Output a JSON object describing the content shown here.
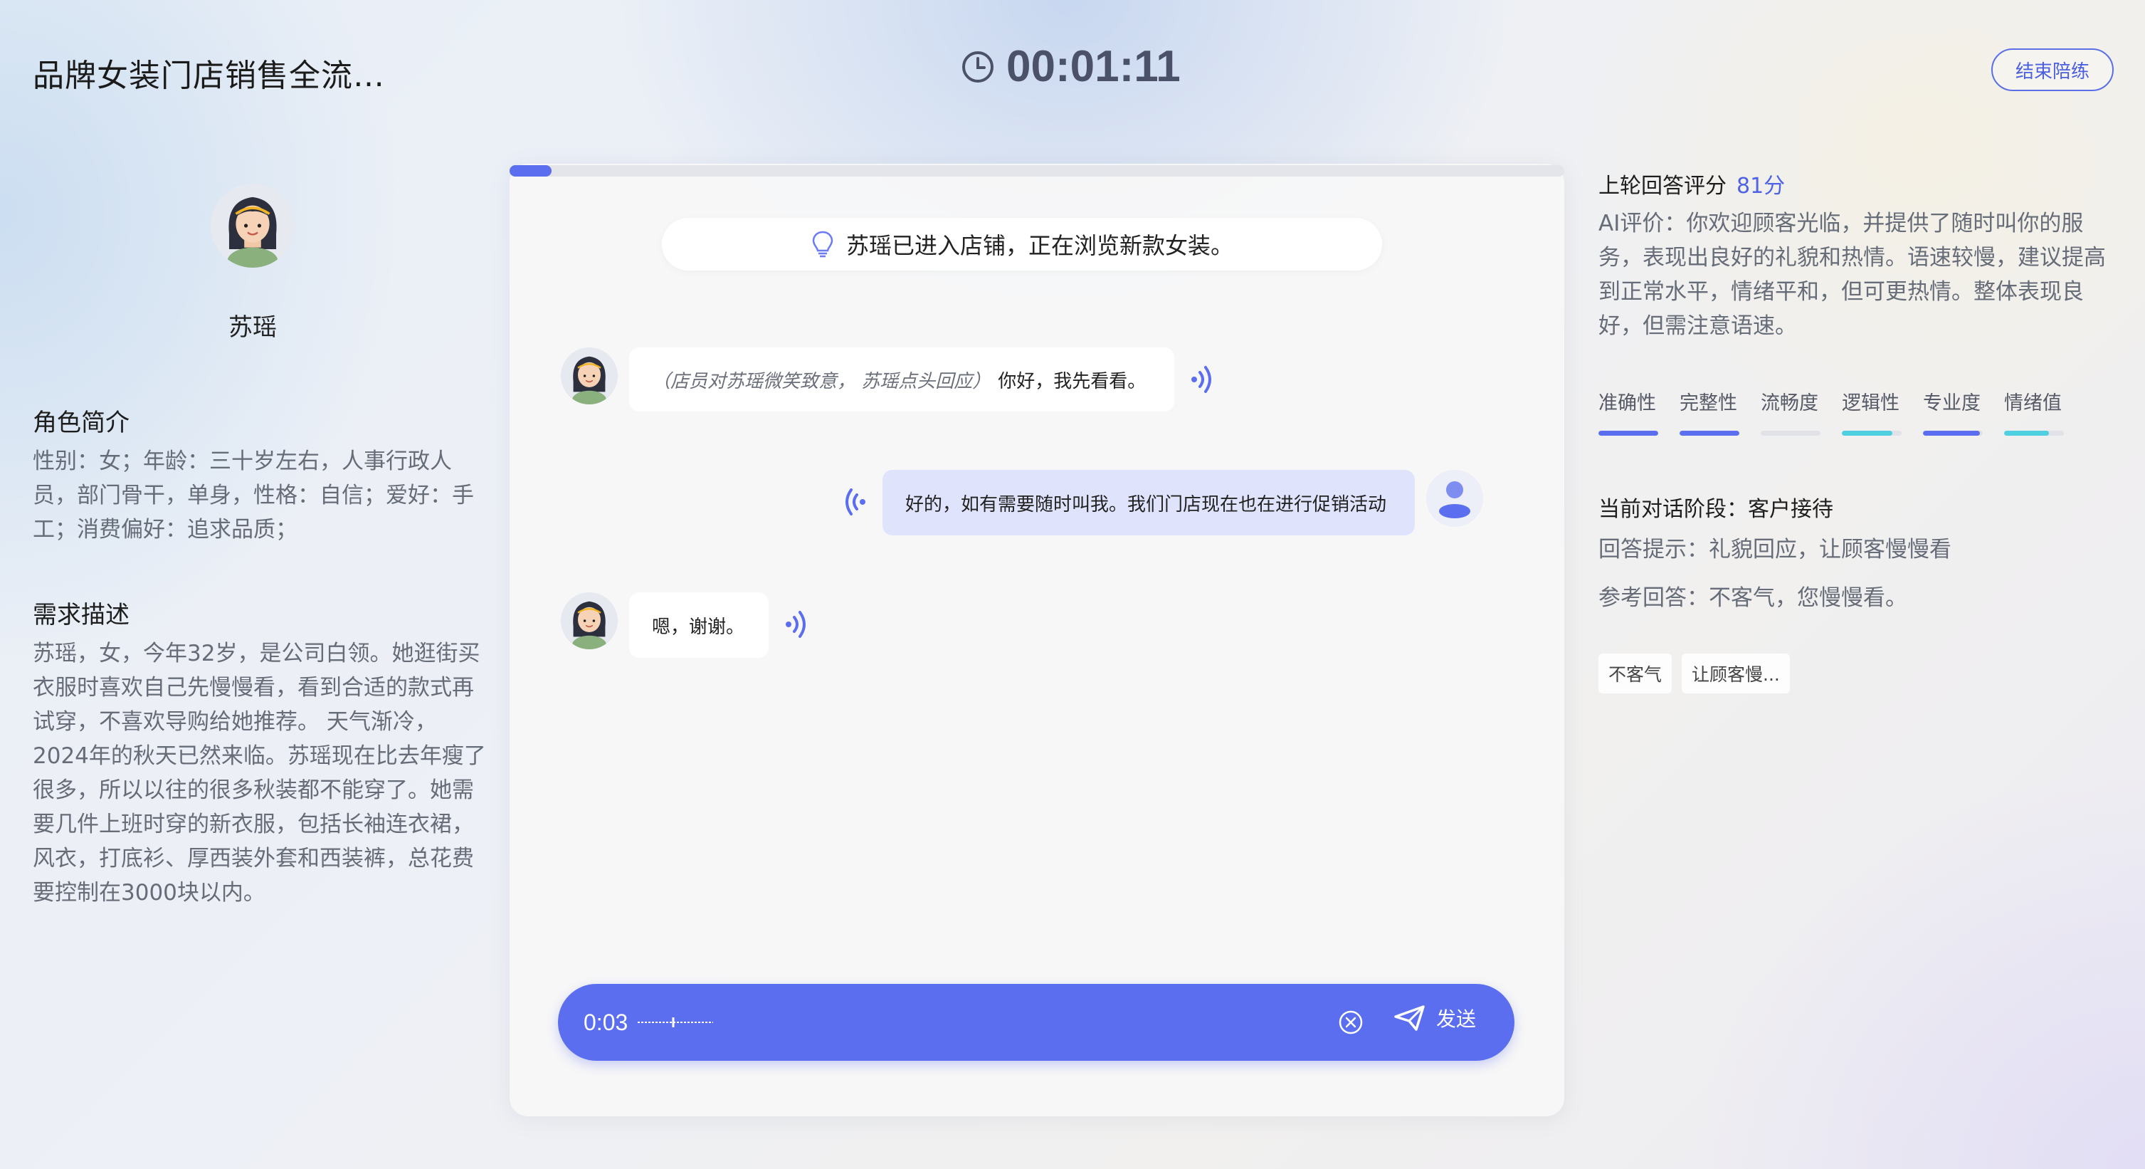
{
  "header": {
    "title": "品牌女装门店销售全流…",
    "timer": "00:01:11",
    "end_button": "结束陪练"
  },
  "character": {
    "name": "苏瑶",
    "intro_title": "角色简介",
    "intro_text": "性别：女；年龄：三十岁左右，人事行政人员，部门骨干，单身，性格：自信；爱好：手工；消费偏好：追求品质；",
    "need_title": "需求描述",
    "need_text": "苏瑶，女，今年32岁，是公司白领。她逛街买衣服时喜欢自己先慢慢看，看到合适的款式再试穿，不喜欢导购给她推荐。 天气渐冷，2024年的秋天已然来临。苏瑶现在比去年瘦了很多，所以以往的很多秋装都不能穿了。她需要几件上班时穿的新衣服，包括长袖连衣裙，风衣，打底衫、厚西装外套和西装裤，总花费要控制在3000块以内。"
  },
  "chat": {
    "progress": 0.04,
    "scene": "苏瑶已进入店铺，正在浏览新款女装。",
    "messages": [
      {
        "role": "customer",
        "action": "（店员对苏瑶微笑致意， 苏瑶点头回应）",
        "text": "你好，我先看看。"
      },
      {
        "role": "user",
        "text": "好的，如有需要随时叫我。我们门店现在也在进行促销活动"
      },
      {
        "role": "customer",
        "text": "嗯，谢谢。"
      }
    ],
    "input": {
      "duration": "0:03",
      "send_label": "发送"
    }
  },
  "feedback": {
    "score_title": "上轮回答评分",
    "score": "81分",
    "evaluation": "AI评价：你欢迎顾客光临，并提供了随时叫你的服务，表现出良好的礼貌和热情。语速较慢，建议提高到正常水平，情绪平和，但可更热情。整体表现良好，但需注意语速。",
    "metrics": [
      {
        "label": "准确性",
        "value": 1.0,
        "color": "#5b6ef0"
      },
      {
        "label": "完整性",
        "value": 1.0,
        "color": "#5b6ef0"
      },
      {
        "label": "流畅度",
        "value": 0.0,
        "color": "#5b6ef0"
      },
      {
        "label": "逻辑性",
        "value": 0.85,
        "color": "#4fd0e0"
      },
      {
        "label": "专业度",
        "value": 0.95,
        "color": "#5b6ef0"
      },
      {
        "label": "情绪值",
        "value": 0.75,
        "color": "#4fd0e0"
      }
    ],
    "stage": "当前对话阶段：客户接待",
    "hint": "回答提示：礼貌回应，让顾客慢慢看",
    "reference": "参考回答：不客气，您慢慢看。",
    "chips": [
      "不客气",
      "让顾客慢..."
    ]
  }
}
